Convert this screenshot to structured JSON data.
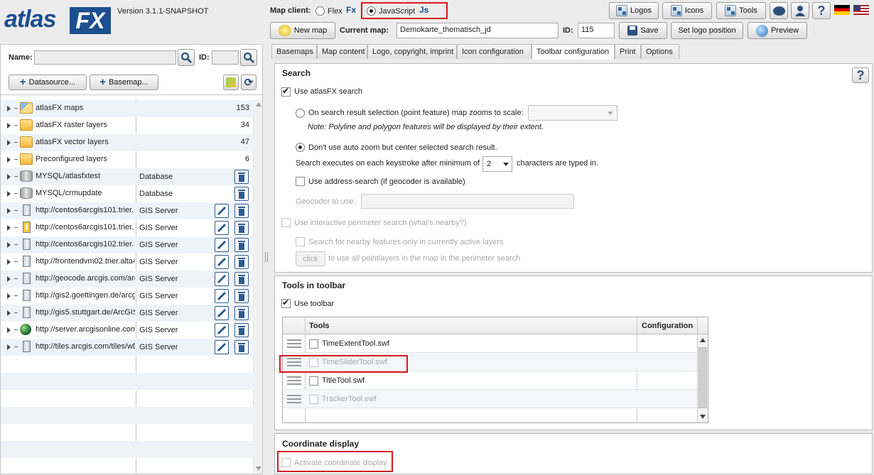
{
  "app": {
    "logo_text_a": "atlas",
    "logo_text_b": "FX",
    "version": "Version 3.1.1-SNAPSHOT"
  },
  "header": {
    "map_client_label": "Map client:",
    "flex_label": "Flex",
    "flex_badge": "Fx",
    "js_label": "JavaScript",
    "js_badge": "Js",
    "new_map_label": "New map",
    "current_map_label": "Current map:",
    "current_map_value": "Demokarte_thematisch_jd",
    "id_label": "ID:",
    "id_value": "115",
    "save_label": "Save",
    "set_logo_label": "Set logo position",
    "preview_label": "Preview",
    "logos_label": "Logos",
    "icons_label": "Icons",
    "tools_label": "Tools"
  },
  "left": {
    "name_label": "Name:",
    "name_value": "",
    "id_label": "ID:",
    "id_value": "",
    "datasource_label": "Datasource...",
    "basemap_label": "Basemap...",
    "rows": [
      {
        "name": "atlasFX maps",
        "type": "",
        "count": "153",
        "icon": "map-folder"
      },
      {
        "name": "atlasFX raster layers",
        "type": "",
        "count": "34",
        "icon": "folder"
      },
      {
        "name": "atlasFX vector layers",
        "type": "",
        "count": "47",
        "icon": "folder"
      },
      {
        "name": "Preconfigured layers",
        "type": "",
        "count": "6",
        "icon": "folder"
      },
      {
        "name": "MYSQL/atlasfxtest",
        "type": "Database",
        "count": "",
        "icon": "database"
      },
      {
        "name": "MYSQL/crmupdate",
        "type": "Database",
        "count": "",
        "icon": "database"
      },
      {
        "name": "http://centos6arcgis101.trier.",
        "type": "GIS Server",
        "count": "",
        "icon": "server"
      },
      {
        "name": "http://centos6arcgis101.trier.",
        "type": "GIS Server",
        "count": "",
        "icon": "server-locked"
      },
      {
        "name": "http://centos6arcgis102.trier.",
        "type": "GIS Server",
        "count": "",
        "icon": "server"
      },
      {
        "name": "http://frontendvm02.trier.alta4",
        "type": "GIS Server",
        "count": "",
        "icon": "server"
      },
      {
        "name": "http://geocode.arcgis.com/arc",
        "type": "GIS Server",
        "count": "",
        "icon": "server"
      },
      {
        "name": "http://gis2.goettingen.de/arcg",
        "type": "GIS Server",
        "count": "",
        "icon": "server"
      },
      {
        "name": "http://gis5.stuttgart.de/ArcGIS",
        "type": "GIS Server",
        "count": "",
        "icon": "server"
      },
      {
        "name": "http://server.arcgisonline.com",
        "type": "GIS Server",
        "count": "",
        "icon": "globe"
      },
      {
        "name": "http://tiles.arcgis.com/tiles/wD",
        "type": "GIS Server",
        "count": "",
        "icon": "server"
      }
    ]
  },
  "tabs": [
    "Basemaps",
    "Map content",
    "Logo, copyright, imprint",
    "Icon configuration",
    "Toolbar configuration",
    "Print",
    "Options"
  ],
  "search": {
    "title": "Search",
    "use_search": "Use atlasFX search",
    "zoom_option": "On search result selection (point feature) map zooms to scale:",
    "note": "Note: Polyline and polygon features will be displayed by their extent.",
    "center_option": "Don't use auto zoom but center selected search result.",
    "keystroke_prefix": "Search executes on each keystroke after minimum of",
    "keystroke_value": "2",
    "keystroke_suffix": "characters are typed in.",
    "address_search": "Use address-search (if geocoder is available)",
    "geocoder_label": "Geocoder to use:",
    "perimeter": "Use interactive perimeter search (what's nearby?)",
    "nearby_active": "Search for nearby features only in currently active layers",
    "click_label": "click",
    "click_suffix": "to use all pointlayers in the map in the perimeter search"
  },
  "toolbar": {
    "title": "Tools in toolbar",
    "use_toolbar": "Use toolbar",
    "col_tools": "Tools",
    "col_config": "Configuration",
    "tools": [
      {
        "name": "TimeExtentTool.swf",
        "enabled": true
      },
      {
        "name": "TimeSliderTool.swf",
        "enabled": false
      },
      {
        "name": "TitleTool.swf",
        "enabled": true
      },
      {
        "name": "TrackerTool.swf",
        "enabled": false
      }
    ]
  },
  "coords": {
    "title": "Coordinate display",
    "activate": "Activate coordinate display"
  }
}
